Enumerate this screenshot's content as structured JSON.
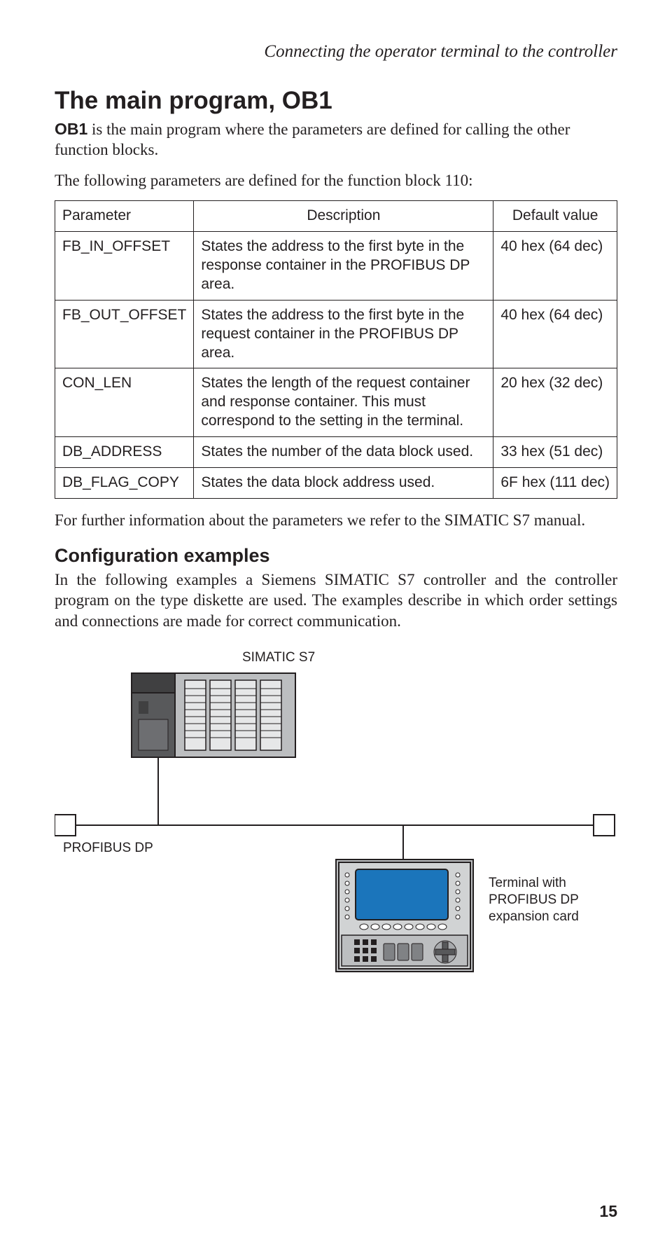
{
  "running_head": "Connecting the operator terminal to the controller",
  "h1": "The main program, OB1",
  "intro_bold": "OB1",
  "intro_rest": " is the main program where the parameters are defined for calling the other function blocks.",
  "intro2": "The following parameters are defined for the function block 110:",
  "table": {
    "headers": [
      "Parameter",
      "Description",
      "Default value"
    ],
    "rows": [
      {
        "p": "FB_IN_OFFSET",
        "d": "States the address to the first byte in the response container in the PROFIBUS DP area.",
        "v": "40 hex (64 dec)"
      },
      {
        "p": "FB_OUT_OFFSET",
        "d": "States the address to the first byte in the request container in the PROFIBUS DP area.",
        "v": "40 hex (64 dec)"
      },
      {
        "p": "CON_LEN",
        "d": "States the length of the request container and response container. This must correspond to the setting in the terminal.",
        "v": "20 hex (32 dec)"
      },
      {
        "p": "DB_ADDRESS",
        "d": "States the number of the data block used.",
        "v": "33 hex (51 dec)"
      },
      {
        "p": "DB_FLAG_COPY",
        "d": "States the data block address used.",
        "v": "6F hex (111 dec)"
      }
    ]
  },
  "after_table": "For further information about the parameters we refer to the SIMATIC S7 manual.",
  "h2": "Configuration examples",
  "examples_intro": "In the following examples a Siemens SIMATIC S7 controller and the controller program on the type diskette are used. The examples describe in which order settings and connections are made for correct communication.",
  "diagram": {
    "simatic_label": "SIMATIC S7",
    "profibus_label": "PROFIBUS DP",
    "terminal_label": "Terminal with PROFIBUS DP expansion card"
  },
  "page_number": "15"
}
